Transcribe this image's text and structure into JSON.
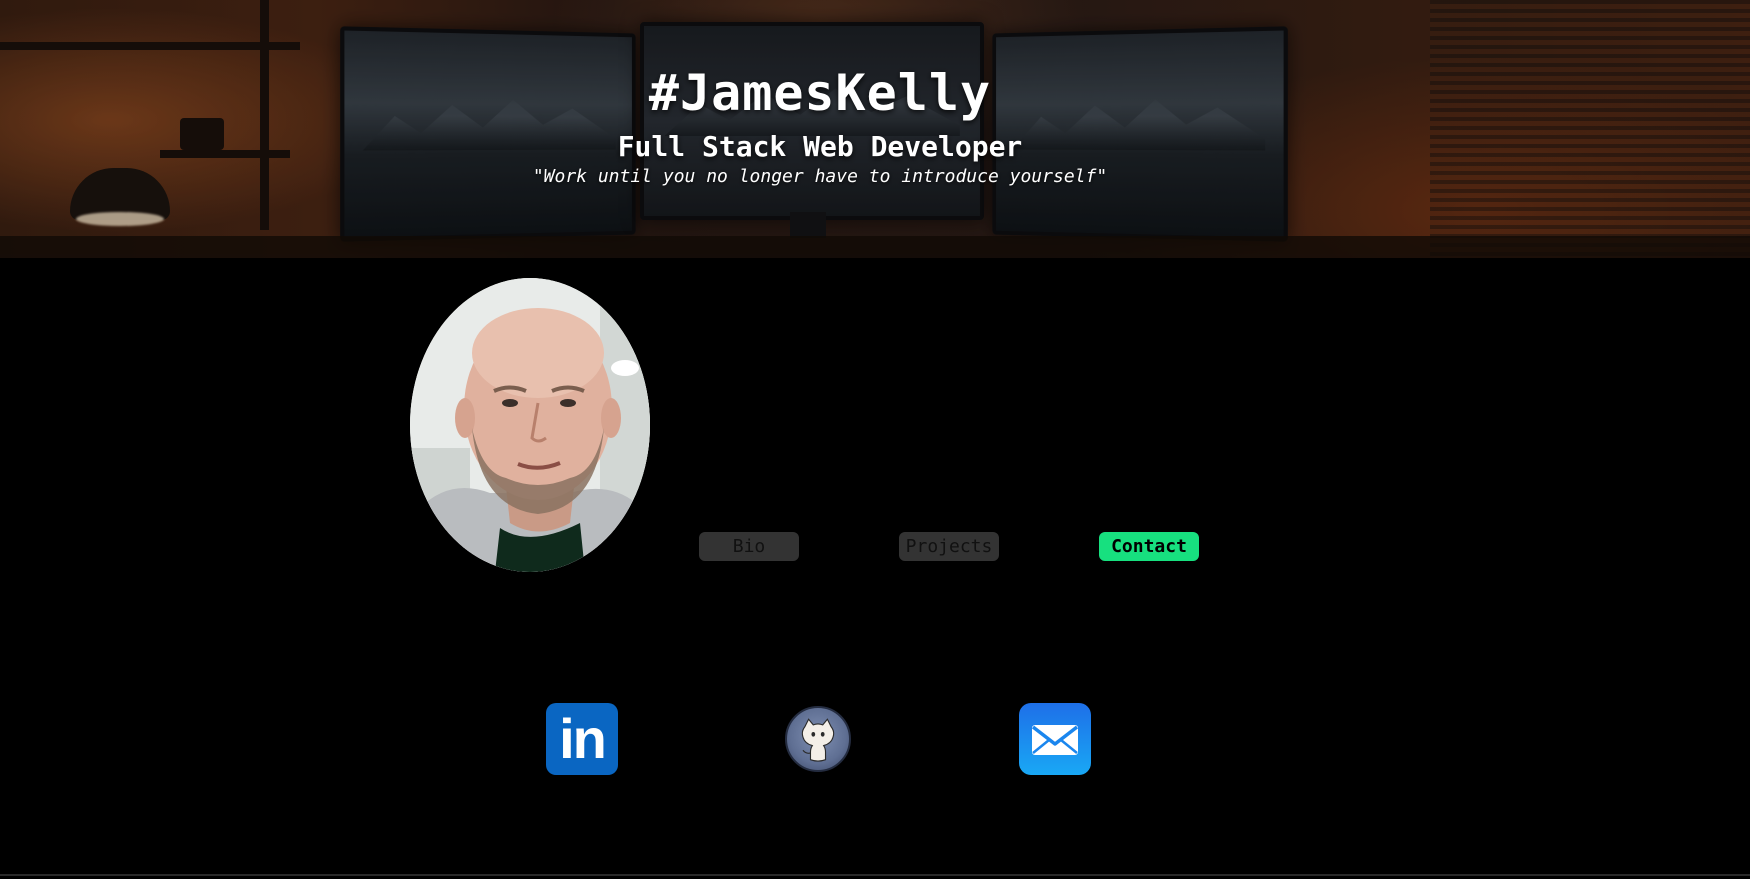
{
  "hero": {
    "title": "#JamesKelly",
    "subtitle": "Full Stack Web Developer",
    "quote": "\"Work until you no longer have to introduce yourself\""
  },
  "nav": {
    "buttons": [
      {
        "label": "Bio",
        "active": false
      },
      {
        "label": "Projects",
        "active": false
      },
      {
        "label": "Contact",
        "active": true
      }
    ]
  },
  "social": [
    {
      "name": "LinkedIn",
      "icon": "linkedin-icon",
      "glyph": "in"
    },
    {
      "name": "GitHub",
      "icon": "github-icon"
    },
    {
      "name": "Email",
      "icon": "mail-icon"
    }
  ],
  "colors": {
    "background": "#000000",
    "accent": "#17e07f",
    "button_inactive": "#333333",
    "linkedin": "#0a66c2",
    "email_top": "#1e6fe8",
    "email_bottom": "#19a8f5"
  }
}
